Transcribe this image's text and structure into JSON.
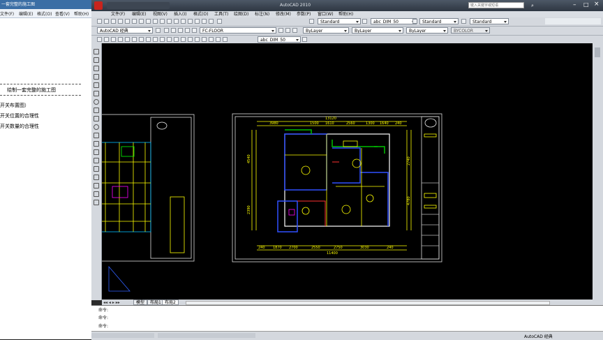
{
  "word": {
    "title": "一套完整的施工图",
    "menu": [
      "文件(F)",
      "编辑(E)",
      "格式(O)",
      "查看(V)",
      "帮助(H)"
    ],
    "heading": "绘制一套完整的施工图",
    "lines": [
      "开关布置图）",
      "开关位置的合理性",
      "开关数量的合理性"
    ]
  },
  "cad": {
    "title": "AutoCAD 2010",
    "search_placeholder": "键入关键字或短语",
    "menu": [
      "文件(F)",
      "编辑(E)",
      "视图(V)",
      "插入(I)",
      "格式(O)",
      "工具(T)",
      "绘图(D)",
      "标注(N)",
      "修改(M)",
      "参数(P)",
      "窗口(W)",
      "帮助(H)"
    ],
    "toolbar1": {
      "style1": "Standard",
      "dimstyle": "abc_DIM_50",
      "style2": "Standard",
      "style3": "Standard"
    },
    "toolbar2": {
      "workspace": "AutoCAD 经典",
      "layer": "FC-FLOOR",
      "color": "ByLayer",
      "linetype": "ByLayer",
      "lineweight": "ByLayer",
      "plotstyle": "BYCOLOR"
    },
    "toolbar3": {
      "dimstyle": "abc_DIM_50"
    },
    "tabs": [
      "模型",
      "布局1",
      "布局2"
    ],
    "commands": [
      "命令:",
      "命令:",
      "命令:"
    ],
    "status_workspace": "AutoCAD 经典"
  },
  "drawing": {
    "dims_top": [
      "3980",
      "1500",
      "1610",
      "2560",
      "1300",
      "1640",
      "240"
    ],
    "total_top": "13120",
    "dims_bottom": [
      "240",
      "1870",
      "2700",
      "2550",
      "2750",
      "3030",
      "240"
    ],
    "total_bottom": "11400",
    "dims_left": [
      "4540",
      "2390"
    ],
    "dims_right": [
      "2740",
      "4780"
    ]
  }
}
